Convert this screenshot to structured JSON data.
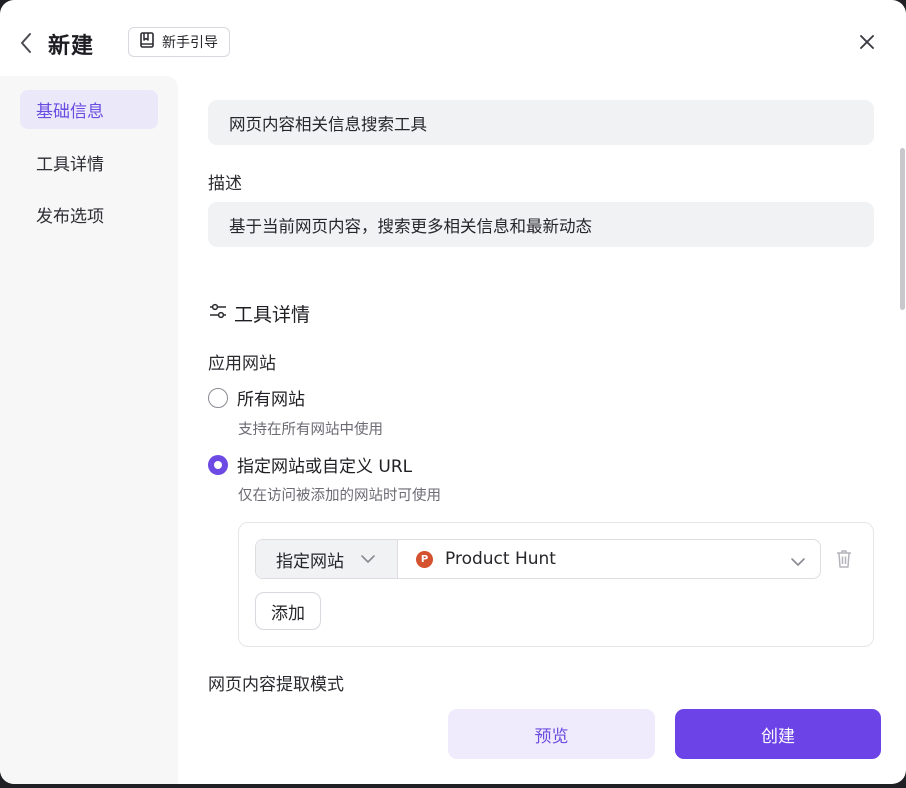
{
  "header": {
    "title": "新建",
    "guide_label": "新手引导"
  },
  "sidebar": {
    "items": [
      {
        "label": "基础信息",
        "active": true
      },
      {
        "label": "工具详情",
        "active": false
      },
      {
        "label": "发布选项",
        "active": false
      }
    ]
  },
  "form": {
    "name_value": "网页内容相关信息搜索工具",
    "description_label": "描述",
    "description_value": "基于当前网页内容，搜索更多相关信息和最新动态",
    "section_title": "工具详情",
    "apply_sites_label": "应用网站",
    "radio_all": {
      "label": "所有网站",
      "hint": "支持在所有网站中使用",
      "checked": false
    },
    "radio_specific": {
      "label": "指定网站或自定义 URL",
      "hint": "仅在访问被添加的网站时可使用",
      "checked": true
    },
    "site_rule": {
      "type_label": "指定网站",
      "site_name": "Product Hunt",
      "site_logo_letter": "P"
    },
    "add_label": "添加",
    "extract_mode_label": "网页内容提取模式"
  },
  "footer": {
    "preview_label": "预览",
    "create_label": "创建"
  },
  "colors": {
    "accent": "#6c43e6",
    "accent_soft": "#efebfc",
    "product_hunt": "#d4522e"
  }
}
